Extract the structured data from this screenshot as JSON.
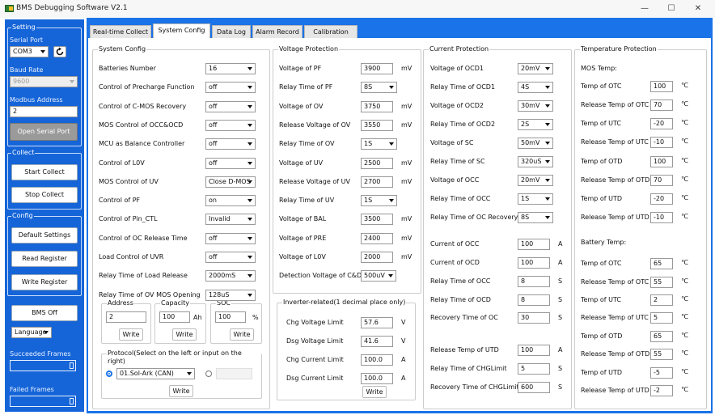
{
  "window": {
    "title": "BMS Debugging Software V2.1",
    "minimize": "—",
    "maximize": "☐",
    "close": "✕"
  },
  "left": {
    "setting_title": "Setting",
    "serial_port_label": "Serial Port",
    "serial_port": "COM3",
    "baud_rate_label": "Baud Rate",
    "baud_rate": "9600",
    "modbus_label": "Modbus Address",
    "modbus_value": "2",
    "open_serial": "Open Serial Port",
    "collect_title": "Collect",
    "start_collect": "Start Collect",
    "stop_collect": "Stop Collect",
    "config_title": "Config",
    "default_settings": "Default Settings",
    "read_register": "Read Register",
    "write_register": "Write Register",
    "bms_off": "BMS Off",
    "language": "Language",
    "succeeded_frames": "Succeeded Frames",
    "failed_frames": "Failed Frames"
  },
  "tabs": [
    "Real-time Collect",
    "System Config",
    "Data Log",
    "Alarm Record",
    "Calibration"
  ],
  "system_config": {
    "title": "System Config",
    "rows": [
      {
        "label": "Batteries Number",
        "value": "16"
      },
      {
        "label": "Control of Precharge Function",
        "value": "off"
      },
      {
        "label": "Control of C-MOS Recovery",
        "value": "off"
      },
      {
        "label": "MOS Control of OCC&OCD",
        "value": "off"
      },
      {
        "label": "MCU as Balance Controller",
        "value": "off"
      },
      {
        "label": "Control of L0V",
        "value": "off"
      },
      {
        "label": "MOS Control of UV",
        "value": "Close D-MOS"
      },
      {
        "label": "Control of PF",
        "value": "on"
      },
      {
        "label": "Control of Pin_CTL",
        "value": "Invalid"
      },
      {
        "label": "Control of OC Release Time",
        "value": "off"
      },
      {
        "label": "Load Control of UVR",
        "value": "off"
      },
      {
        "label": "Relay Time of Load Release",
        "value": "2000mS"
      },
      {
        "label": "Relay Time of OV MOS Opening",
        "value": "128uS"
      }
    ],
    "address_title": "Address",
    "address_value": "2",
    "capacity_title": "Capacity",
    "capacity_value": "100",
    "capacity_unit": "Ah",
    "soc_title": "SOC",
    "soc_value": "100",
    "soc_unit": "%",
    "write": "Write",
    "protocol_title": "Protocol(Select on the left or input on the right)",
    "protocol_value": "01.Sol-Ark (CAN)"
  },
  "voltage_protection": {
    "title": "Voltage Protection",
    "rows": [
      {
        "label": "Voltage of PF",
        "value": "3900",
        "unit": "mV",
        "type": "input"
      },
      {
        "label": "Relay Time of PF",
        "value": "8S",
        "unit": "",
        "type": "select"
      },
      {
        "label": "Voltage of OV",
        "value": "3750",
        "unit": "mV",
        "type": "input"
      },
      {
        "label": "Release Voltage of OV",
        "value": "3550",
        "unit": "mV",
        "type": "input"
      },
      {
        "label": "Relay Time of OV",
        "value": "1S",
        "unit": "",
        "type": "select"
      },
      {
        "label": "Voltage of UV",
        "value": "2500",
        "unit": "mV",
        "type": "input"
      },
      {
        "label": "Release Voltage of UV",
        "value": "2700",
        "unit": "mV",
        "type": "input"
      },
      {
        "label": "Relay Time of UV",
        "value": "1S",
        "unit": "",
        "type": "select"
      },
      {
        "label": "Voltage of BAL",
        "value": "3500",
        "unit": "mV",
        "type": "input"
      },
      {
        "label": "Voltage of PRE",
        "value": "2400",
        "unit": "mV",
        "type": "input"
      },
      {
        "label": "Voltage of L0V",
        "value": "2000",
        "unit": "mV",
        "type": "input"
      },
      {
        "label": "Detection Voltage of C&D",
        "value": "500uV",
        "unit": "",
        "type": "select"
      }
    ]
  },
  "inverter": {
    "title": "Inverter-related(1 decimal place only)",
    "rows": [
      {
        "label": "Chg Voltage Limit",
        "value": "57.6",
        "unit": "V"
      },
      {
        "label": "Dsg Voltage Limit",
        "value": "41.6",
        "unit": "V"
      },
      {
        "label": "Chg Current Limit",
        "value": "100.0",
        "unit": "A"
      },
      {
        "label": "Dsg Current Limit",
        "value": "100.0",
        "unit": "A"
      }
    ],
    "write": "Write"
  },
  "current_protection": {
    "title": "Current Protection",
    "rows": [
      {
        "label": "Voltage of OCD1",
        "value": "20mV",
        "unit": "",
        "type": "select"
      },
      {
        "label": "Relay Time of OCD1",
        "value": "4S",
        "unit": "",
        "type": "select"
      },
      {
        "label": "Voltage of OCD2",
        "value": "30mV",
        "unit": "",
        "type": "select"
      },
      {
        "label": "Relay Time of OCD2",
        "value": "2S",
        "unit": "",
        "type": "select"
      },
      {
        "label": "Voltage of SC",
        "value": "50mV",
        "unit": "",
        "type": "select"
      },
      {
        "label": "Relay Time of SC",
        "value": "320uS",
        "unit": "",
        "type": "select"
      },
      {
        "label": "Voltage of OCC",
        "value": "20mV",
        "unit": "",
        "type": "select"
      },
      {
        "label": "Relay Time of OCC",
        "value": "1S",
        "unit": "",
        "type": "select"
      },
      {
        "label": "Relay Time of OC Recovery",
        "value": "8S",
        "unit": "",
        "type": "select"
      },
      {
        "label": "Current of OCC",
        "value": "100",
        "unit": "A",
        "type": "input"
      },
      {
        "label": "Current of OCD",
        "value": "100",
        "unit": "A",
        "type": "input"
      },
      {
        "label": "Relay Time of OCC",
        "value": "8",
        "unit": "S",
        "type": "input"
      },
      {
        "label": "Relay Time of OCD",
        "value": "8",
        "unit": "S",
        "type": "input"
      },
      {
        "label": "Recovery Time of OC",
        "value": "30",
        "unit": "S",
        "type": "input"
      },
      {
        "label": "Release Temp of UTD",
        "value": "100",
        "unit": "A",
        "type": "input"
      },
      {
        "label": "Relay Time of CHGLimit",
        "value": "5",
        "unit": "S",
        "type": "input"
      },
      {
        "label": "Recovery Time of CHGLimit",
        "value": "600",
        "unit": "S",
        "type": "input"
      }
    ]
  },
  "temperature_protection": {
    "title": "Temperature Protection",
    "mos_title": "MOS Temp:",
    "battery_title": "Battery Temp:",
    "unit": "℃",
    "mos_rows": [
      {
        "label": "Temp of OTC",
        "value": "100"
      },
      {
        "label": "Release Temp of OTC",
        "value": "70"
      },
      {
        "label": "Temp of UTC",
        "value": "-20"
      },
      {
        "label": "Release Temp of UTC",
        "value": "-10"
      },
      {
        "label": "Temp of OTD",
        "value": "100"
      },
      {
        "label": "Release Temp of OTD",
        "value": "70"
      },
      {
        "label": "Temp of UTD",
        "value": "-20"
      },
      {
        "label": "Release Temp of UTD",
        "value": "-10"
      }
    ],
    "battery_rows": [
      {
        "label": "Temp of OTC",
        "value": "65"
      },
      {
        "label": "Release Temp of OTC",
        "value": "55"
      },
      {
        "label": "Temp of UTC",
        "value": "2"
      },
      {
        "label": "Release Temp of UTC",
        "value": "5"
      },
      {
        "label": "Temp of OTD",
        "value": "65"
      },
      {
        "label": "Release Temp of OTD",
        "value": "55"
      },
      {
        "label": "Temp of UTD",
        "value": "-5"
      },
      {
        "label": "Release Temp of UTD",
        "value": "-2"
      }
    ]
  }
}
